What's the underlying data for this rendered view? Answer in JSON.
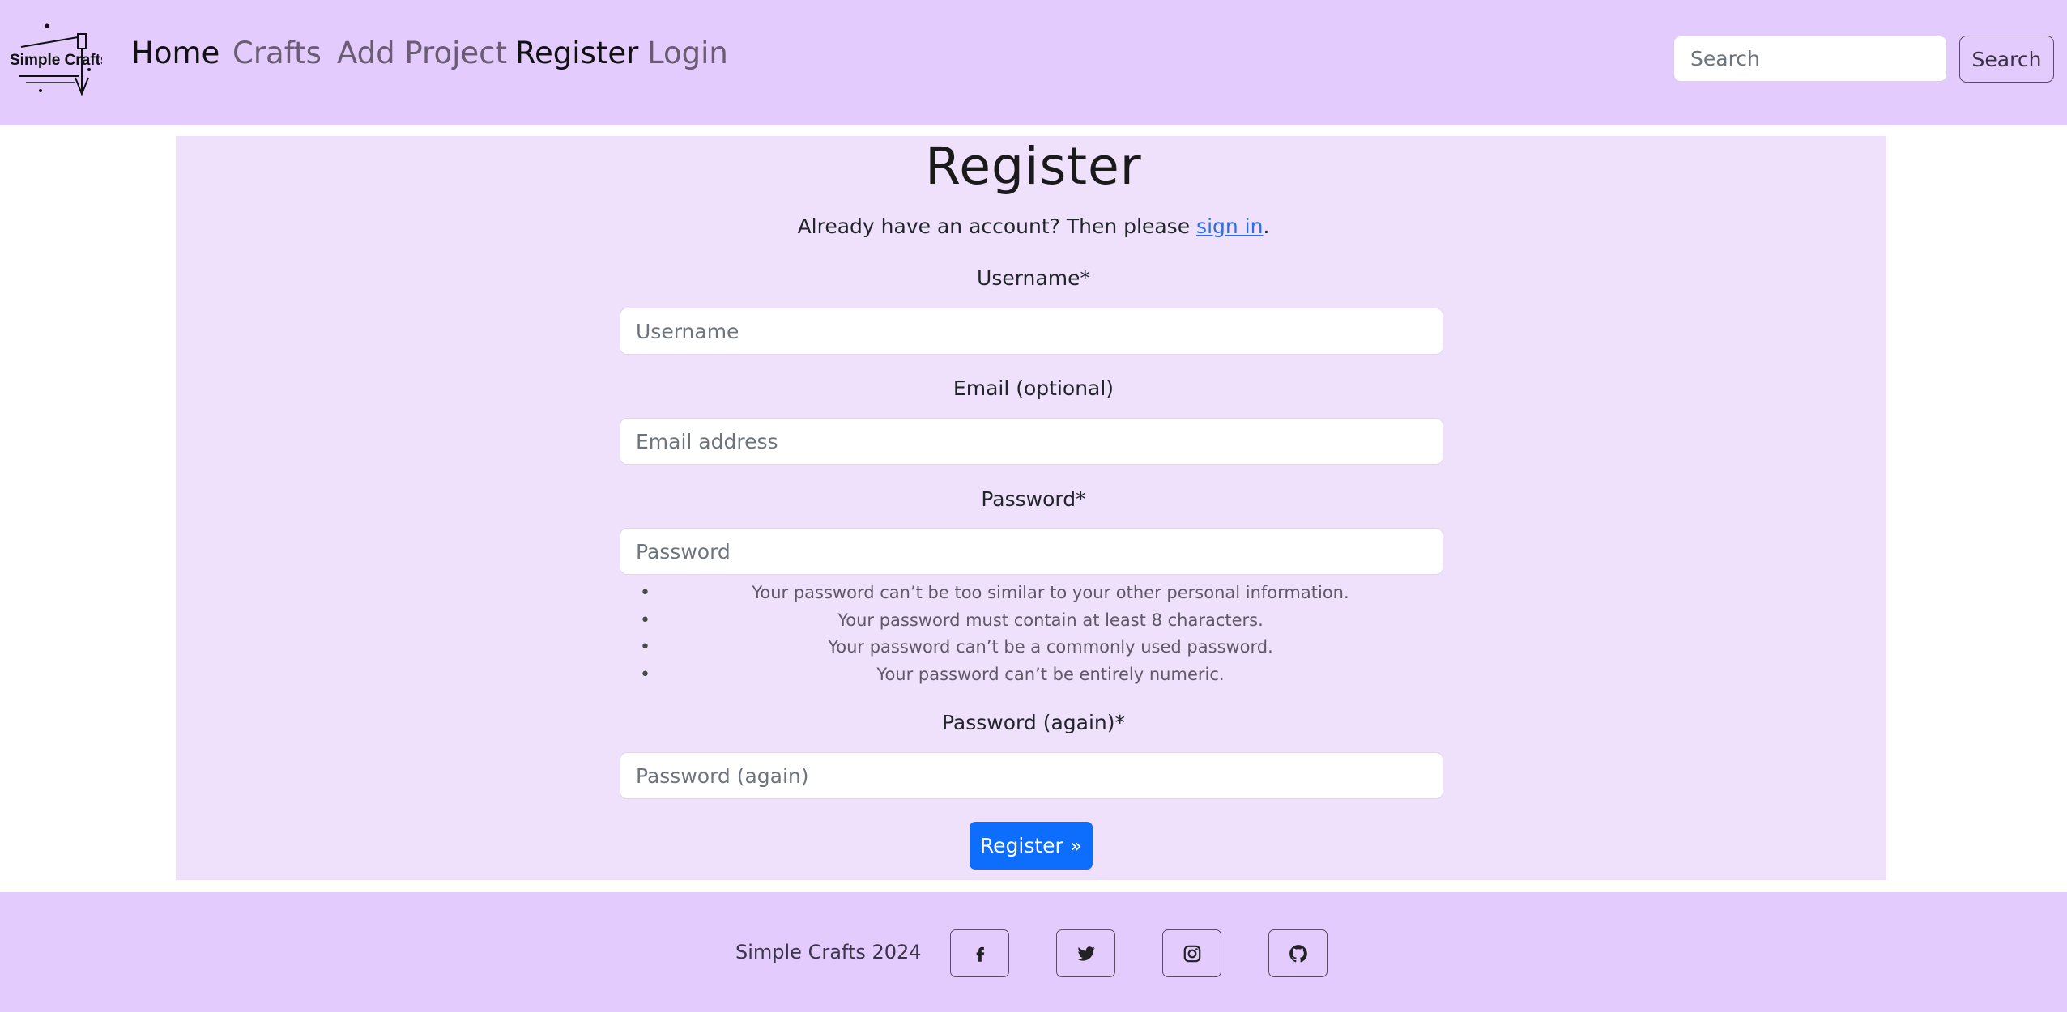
{
  "brand": {
    "logo_text": "Simple Crafts"
  },
  "nav": {
    "items": [
      {
        "label": "Home",
        "state": "active"
      },
      {
        "label": "Crafts",
        "state": "muted"
      },
      {
        "label": "Add Project",
        "state": "muted"
      },
      {
        "label": "Register",
        "state": "active"
      },
      {
        "label": "Login",
        "state": "muted"
      }
    ],
    "search": {
      "placeholder": "Search",
      "button_label": "Search"
    }
  },
  "form": {
    "title": "Register",
    "signin_prefix": "Already have an account? Then please ",
    "signin_link": "sign in",
    "signin_suffix": ".",
    "fields": [
      {
        "label": "Username*",
        "placeholder": "Username"
      },
      {
        "label": "Email (optional)",
        "placeholder": "Email address"
      },
      {
        "label": "Password*",
        "placeholder": "Password"
      },
      {
        "label": "Password (again)*",
        "placeholder": "Password (again)"
      }
    ],
    "password_help": [
      "Your password can’t be too similar to your other personal information.",
      "Your password must contain at least 8 characters.",
      "Your password can’t be a commonly used password.",
      "Your password can’t be entirely numeric."
    ],
    "submit_label": "Register »"
  },
  "footer": {
    "copyright": "Simple Crafts 2024",
    "social": [
      "facebook-icon",
      "twitter-icon",
      "instagram-icon",
      "github-icon"
    ]
  },
  "colors": {
    "nav_bg": "#e3cbfd",
    "card_bg": "#efe0fc",
    "primary": "#0d6efd",
    "link": "#2a6ee8"
  }
}
